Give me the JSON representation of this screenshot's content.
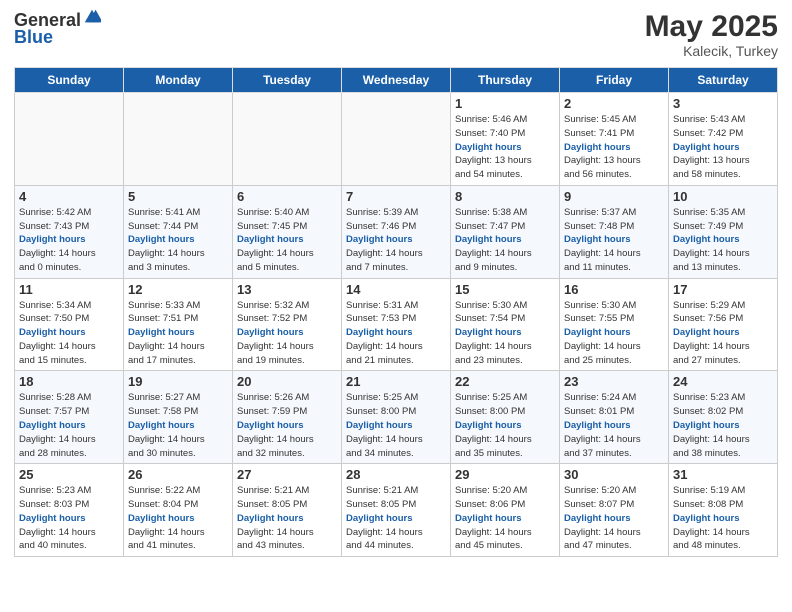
{
  "logo": {
    "general": "General",
    "blue": "Blue"
  },
  "title": {
    "month_year": "May 2025",
    "location": "Kalecik, Turkey"
  },
  "days_of_week": [
    "Sunday",
    "Monday",
    "Tuesday",
    "Wednesday",
    "Thursday",
    "Friday",
    "Saturday"
  ],
  "weeks": [
    [
      {
        "day": "",
        "empty": true
      },
      {
        "day": "",
        "empty": true
      },
      {
        "day": "",
        "empty": true
      },
      {
        "day": "",
        "empty": true
      },
      {
        "day": "1",
        "sunrise": "Sunrise: 5:46 AM",
        "sunset": "Sunset: 7:40 PM",
        "daylight": "Daylight: 13 hours",
        "daylight2": "and 54 minutes."
      },
      {
        "day": "2",
        "sunrise": "Sunrise: 5:45 AM",
        "sunset": "Sunset: 7:41 PM",
        "daylight": "Daylight: 13 hours",
        "daylight2": "and 56 minutes."
      },
      {
        "day": "3",
        "sunrise": "Sunrise: 5:43 AM",
        "sunset": "Sunset: 7:42 PM",
        "daylight": "Daylight: 13 hours",
        "daylight2": "and 58 minutes."
      }
    ],
    [
      {
        "day": "4",
        "sunrise": "Sunrise: 5:42 AM",
        "sunset": "Sunset: 7:43 PM",
        "daylight": "Daylight: 14 hours",
        "daylight2": "and 0 minutes."
      },
      {
        "day": "5",
        "sunrise": "Sunrise: 5:41 AM",
        "sunset": "Sunset: 7:44 PM",
        "daylight": "Daylight: 14 hours",
        "daylight2": "and 3 minutes."
      },
      {
        "day": "6",
        "sunrise": "Sunrise: 5:40 AM",
        "sunset": "Sunset: 7:45 PM",
        "daylight": "Daylight: 14 hours",
        "daylight2": "and 5 minutes."
      },
      {
        "day": "7",
        "sunrise": "Sunrise: 5:39 AM",
        "sunset": "Sunset: 7:46 PM",
        "daylight": "Daylight: 14 hours",
        "daylight2": "and 7 minutes."
      },
      {
        "day": "8",
        "sunrise": "Sunrise: 5:38 AM",
        "sunset": "Sunset: 7:47 PM",
        "daylight": "Daylight: 14 hours",
        "daylight2": "and 9 minutes."
      },
      {
        "day": "9",
        "sunrise": "Sunrise: 5:37 AM",
        "sunset": "Sunset: 7:48 PM",
        "daylight": "Daylight: 14 hours",
        "daylight2": "and 11 minutes."
      },
      {
        "day": "10",
        "sunrise": "Sunrise: 5:35 AM",
        "sunset": "Sunset: 7:49 PM",
        "daylight": "Daylight: 14 hours",
        "daylight2": "and 13 minutes."
      }
    ],
    [
      {
        "day": "11",
        "sunrise": "Sunrise: 5:34 AM",
        "sunset": "Sunset: 7:50 PM",
        "daylight": "Daylight: 14 hours",
        "daylight2": "and 15 minutes."
      },
      {
        "day": "12",
        "sunrise": "Sunrise: 5:33 AM",
        "sunset": "Sunset: 7:51 PM",
        "daylight": "Daylight: 14 hours",
        "daylight2": "and 17 minutes."
      },
      {
        "day": "13",
        "sunrise": "Sunrise: 5:32 AM",
        "sunset": "Sunset: 7:52 PM",
        "daylight": "Daylight: 14 hours",
        "daylight2": "and 19 minutes."
      },
      {
        "day": "14",
        "sunrise": "Sunrise: 5:31 AM",
        "sunset": "Sunset: 7:53 PM",
        "daylight": "Daylight: 14 hours",
        "daylight2": "and 21 minutes."
      },
      {
        "day": "15",
        "sunrise": "Sunrise: 5:30 AM",
        "sunset": "Sunset: 7:54 PM",
        "daylight": "Daylight: 14 hours",
        "daylight2": "and 23 minutes."
      },
      {
        "day": "16",
        "sunrise": "Sunrise: 5:30 AM",
        "sunset": "Sunset: 7:55 PM",
        "daylight": "Daylight: 14 hours",
        "daylight2": "and 25 minutes."
      },
      {
        "day": "17",
        "sunrise": "Sunrise: 5:29 AM",
        "sunset": "Sunset: 7:56 PM",
        "daylight": "Daylight: 14 hours",
        "daylight2": "and 27 minutes."
      }
    ],
    [
      {
        "day": "18",
        "sunrise": "Sunrise: 5:28 AM",
        "sunset": "Sunset: 7:57 PM",
        "daylight": "Daylight: 14 hours",
        "daylight2": "and 28 minutes."
      },
      {
        "day": "19",
        "sunrise": "Sunrise: 5:27 AM",
        "sunset": "Sunset: 7:58 PM",
        "daylight": "Daylight: 14 hours",
        "daylight2": "and 30 minutes."
      },
      {
        "day": "20",
        "sunrise": "Sunrise: 5:26 AM",
        "sunset": "Sunset: 7:59 PM",
        "daylight": "Daylight: 14 hours",
        "daylight2": "and 32 minutes."
      },
      {
        "day": "21",
        "sunrise": "Sunrise: 5:25 AM",
        "sunset": "Sunset: 8:00 PM",
        "daylight": "Daylight: 14 hours",
        "daylight2": "and 34 minutes."
      },
      {
        "day": "22",
        "sunrise": "Sunrise: 5:25 AM",
        "sunset": "Sunset: 8:00 PM",
        "daylight": "Daylight: 14 hours",
        "daylight2": "and 35 minutes."
      },
      {
        "day": "23",
        "sunrise": "Sunrise: 5:24 AM",
        "sunset": "Sunset: 8:01 PM",
        "daylight": "Daylight: 14 hours",
        "daylight2": "and 37 minutes."
      },
      {
        "day": "24",
        "sunrise": "Sunrise: 5:23 AM",
        "sunset": "Sunset: 8:02 PM",
        "daylight": "Daylight: 14 hours",
        "daylight2": "and 38 minutes."
      }
    ],
    [
      {
        "day": "25",
        "sunrise": "Sunrise: 5:23 AM",
        "sunset": "Sunset: 8:03 PM",
        "daylight": "Daylight: 14 hours",
        "daylight2": "and 40 minutes."
      },
      {
        "day": "26",
        "sunrise": "Sunrise: 5:22 AM",
        "sunset": "Sunset: 8:04 PM",
        "daylight": "Daylight: 14 hours",
        "daylight2": "and 41 minutes."
      },
      {
        "day": "27",
        "sunrise": "Sunrise: 5:21 AM",
        "sunset": "Sunset: 8:05 PM",
        "daylight": "Daylight: 14 hours",
        "daylight2": "and 43 minutes."
      },
      {
        "day": "28",
        "sunrise": "Sunrise: 5:21 AM",
        "sunset": "Sunset: 8:05 PM",
        "daylight": "Daylight: 14 hours",
        "daylight2": "and 44 minutes."
      },
      {
        "day": "29",
        "sunrise": "Sunrise: 5:20 AM",
        "sunset": "Sunset: 8:06 PM",
        "daylight": "Daylight: 14 hours",
        "daylight2": "and 45 minutes."
      },
      {
        "day": "30",
        "sunrise": "Sunrise: 5:20 AM",
        "sunset": "Sunset: 8:07 PM",
        "daylight": "Daylight: 14 hours",
        "daylight2": "and 47 minutes."
      },
      {
        "day": "31",
        "sunrise": "Sunrise: 5:19 AM",
        "sunset": "Sunset: 8:08 PM",
        "daylight": "Daylight: 14 hours",
        "daylight2": "and 48 minutes."
      }
    ]
  ]
}
